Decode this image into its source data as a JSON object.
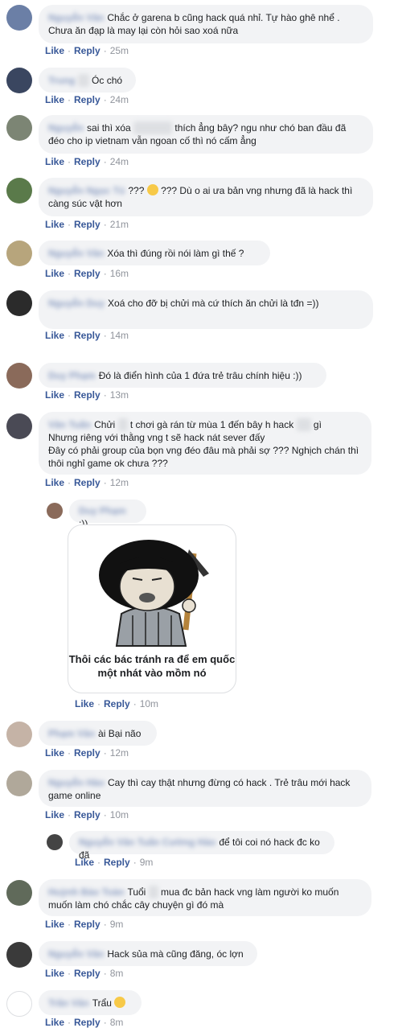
{
  "actions": {
    "like": "Like",
    "reply": "Reply",
    "dot": "·"
  },
  "comments": [
    {
      "name": "Nguyễn Văn",
      "text": "Chắc ở garena b cũng hack quá nhỉ. Tự hào ghê nhể . Chưa ăn đạp là may lại còn hỏi sao xoá nữa",
      "time": "25m"
    },
    {
      "name": "Trung",
      "hidden": "Lê",
      "text": "Óc chó",
      "time": "24m"
    },
    {
      "name": "Nguyễn",
      "text": "sai thì xóa",
      "text2": "thích ẳng bây? ngu như chó ban đầu đã đéo cho ip vietnam vẫn ngoan cố thì nó cấm ẳng",
      "time": "24m"
    },
    {
      "name": "Nguyễn Ngọc Tú",
      "text": "???",
      "text2": "??? Dù o ai ưa bản vng nhưng đã là hack thì càng súc vật hơn",
      "time": "21m"
    },
    {
      "name": "Nguyễn Văn",
      "text": "Xóa thì đúng rồi nói làm gì thế ?",
      "time": "16m"
    },
    {
      "name": "Nguyễn Duy",
      "text": "Xoá cho đỡ bị chửi mà cứ thích ăn chửi là tđn =))",
      "time": "14m"
    },
    {
      "name": "Duy Phạm",
      "text": "Đó là điển hình của 1 đứa trẻ trâu chính hiệu :))",
      "time": "13m"
    },
    {
      "name": "Văn Tuấn",
      "text": "Chửi",
      "text2": "t chơi gà rán từ mùa 1 đến bây h hack",
      "text3": "gì",
      "line2": "Nhưng riêng với thằng vng t sẽ hack nát sever đấy",
      "line3": "Đây có phải group của bọn vng đéo đâu mà phải sợ ??? Nghịch chán thì thôi nghỉ game ok chưa ???",
      "time": "12m"
    },
    {
      "name": "Duy Phạm",
      "text": ":))",
      "sticker": "Thôi các bác tránh ra để em quốc một nhát vào mồm nó",
      "time": "10m"
    },
    {
      "name": "Phạm Văn",
      "text": "ài Bại não",
      "time": "12m"
    },
    {
      "name": "Nguyễn Hào",
      "text": "Cay thì cay thật nhưng đừng có hack . Trẻ trâu mới hack game online",
      "time": "10m"
    },
    {
      "name": "Nguyễn Văn Tuấn Cường Hảo",
      "text": "để tôi coi nó hack đc ko đã",
      "time": "9m"
    },
    {
      "name": "Huỳnh Bảo Toàn",
      "text": "Tuổi",
      "text2": "mua đc bản hack vng làm người ko muốn muốn làm chó chắc cây chuyện gì đó mà",
      "time": "9m"
    },
    {
      "name": "Nguyễn Văn",
      "text": "Hack sủa mà cũng đăng, óc lợn",
      "time": "8m"
    },
    {
      "name": "Trần Văn",
      "text": "Trẩu",
      "time": "8m"
    }
  ]
}
